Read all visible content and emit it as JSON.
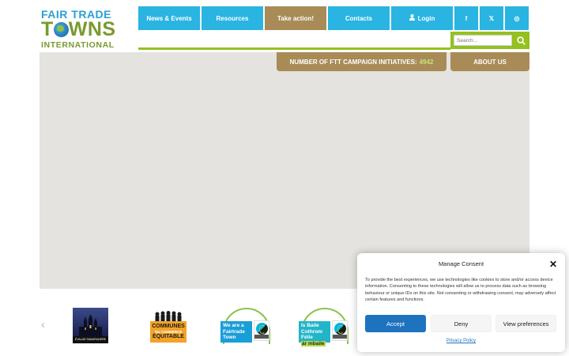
{
  "logo": {
    "line1": "FAIR TRADE",
    "line2_a": "T",
    "line2_b": "WNS",
    "line3": "INTERNATIONAL"
  },
  "nav": {
    "items": [
      {
        "label": "News & Events"
      },
      {
        "label": "Resources"
      },
      {
        "label": "Take action!"
      },
      {
        "label": "Contacts"
      },
      {
        "label": "Login",
        "icon": "user-icon"
      }
    ],
    "social": [
      {
        "icon": "facebook-icon",
        "glyph": "f"
      },
      {
        "icon": "x-icon",
        "glyph": "𝕏"
      },
      {
        "icon": "instagram-icon",
        "glyph": "◎"
      }
    ]
  },
  "search": {
    "placeholder": "Search...",
    "icon": "search-icon"
  },
  "map": {
    "counter_label": "NUMBER OF FTT CAMPAIGN INITIATIVES:",
    "counter_value": "4942",
    "about_label": "ABOUT US"
  },
  "carousel": {
    "prev_glyph": "‹",
    "items": [
      {
        "name": "city-logo",
        "caption": "ÉVALAR SAMARANERE LIBRAZ"
      },
      {
        "name": "communes-logo",
        "line1": "COMMUNES",
        "line2": "DU COMMERCE",
        "line3": "ÉQUITABLE"
      },
      {
        "name": "fairtrade-town-logo",
        "text1": "We are a",
        "text2": "Fairtrade",
        "text3": "Town"
      },
      {
        "name": "baile-logo",
        "text1": "Is Baile",
        "text2": "Cothrom Féile",
        "text3": "ár mbaile"
      }
    ]
  },
  "consent": {
    "title": "Manage Consent",
    "close_glyph": "✕",
    "body": "To provide the best experiences, we use technologies like cookies to store and/or access device information. Consenting to these technologies will allow us to process data such as browsing behaviour or unique IDs on this site. Not consenting or withdrawing consent, may adversely affect certain features and functions.",
    "accept": "Accept",
    "deny": "Deny",
    "preferences": "View preferences",
    "policy": "Privacy Policy"
  },
  "colors": {
    "nav_blue": "#29b4e2",
    "brown": "#a88b57",
    "green": "#94c11f",
    "accept_blue": "#1e73be",
    "map_gray": "#e5e3df"
  }
}
